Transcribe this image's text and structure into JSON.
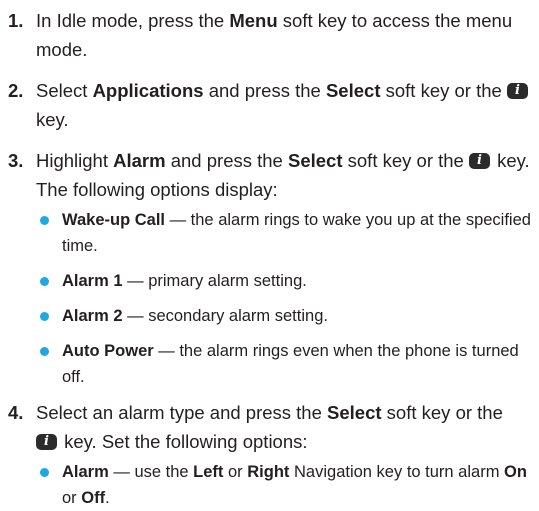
{
  "steps": [
    {
      "number": "1.",
      "segments": [
        {
          "t": "In Idle mode, press the "
        },
        {
          "t": "Menu",
          "b": true
        },
        {
          "t": " soft key to access the menu mode."
        }
      ]
    },
    {
      "number": "2.",
      "segments": [
        {
          "t": "Select "
        },
        {
          "t": "Applications",
          "b": true
        },
        {
          "t": " and press the "
        },
        {
          "t": "Select",
          "b": true
        },
        {
          "t": " soft key or the "
        },
        {
          "icon": "i-key-icon"
        },
        {
          "t": " key."
        }
      ]
    },
    {
      "number": "3.",
      "segments": [
        {
          "t": "Highlight "
        },
        {
          "t": "Alarm",
          "b": true
        },
        {
          "t": " and press the "
        },
        {
          "t": "Select",
          "b": true
        },
        {
          "t": " soft key or the "
        },
        {
          "icon": "i-key-icon"
        },
        {
          "t": " key. The following options display:"
        }
      ],
      "bullets": [
        [
          {
            "t": "Wake-up Call",
            "b": true
          },
          {
            "t": " — the alarm rings to wake you up at the specified time."
          }
        ],
        [
          {
            "t": "Alarm 1",
            "b": true
          },
          {
            "t": " — primary alarm setting."
          }
        ],
        [
          {
            "t": "Alarm 2",
            "b": true
          },
          {
            "t": " — secondary alarm setting."
          }
        ],
        [
          {
            "t": "Auto Power",
            "b": true
          },
          {
            "t": " — the alarm rings even when the phone is turned off."
          }
        ]
      ]
    },
    {
      "number": "4.",
      "segments": [
        {
          "t": "Select an alarm type and press the "
        },
        {
          "t": "Select",
          "b": true
        },
        {
          "t": " soft key or the "
        },
        {
          "icon": "i-key-icon"
        },
        {
          "t": " key. Set the following options:"
        }
      ],
      "bullets": [
        [
          {
            "t": "Alarm",
            "b": true
          },
          {
            "t": " — use the "
          },
          {
            "t": "Left",
            "b": true
          },
          {
            "t": " or "
          },
          {
            "t": "Right",
            "b": true
          },
          {
            "t": " Navigation key to turn alarm "
          },
          {
            "t": "On",
            "b": true
          },
          {
            "t": " or "
          },
          {
            "t": "Off",
            "b": true
          },
          {
            "t": "."
          }
        ]
      ]
    }
  ],
  "colors": {
    "bullet": "#1fa7e0",
    "text": "#231f20"
  }
}
